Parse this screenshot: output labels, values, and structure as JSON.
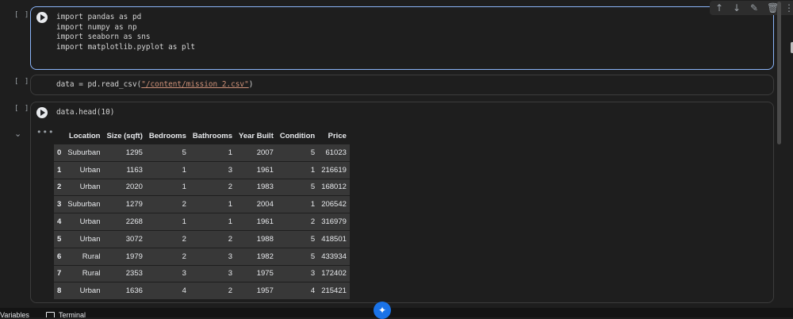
{
  "cells": [
    {
      "bracket": "[ ]",
      "code": "import pandas as pd\nimport numpy as np\nimport seaborn as sns\nimport matplotlib.pyplot as plt"
    },
    {
      "bracket": "[ ]",
      "code_pre": "data = pd.read_csv(",
      "code_str": "\"/content/mission 2.csv\"",
      "code_post": ")"
    },
    {
      "bracket": "[ ]",
      "code": "data.head(10)"
    }
  ],
  "toolbar": {
    "up": "↑",
    "down": "↓",
    "edit": "✎",
    "delete": "🗑",
    "more": "⋮"
  },
  "output": {
    "collapse": "⌄",
    "dots": "•••",
    "columns": [
      "",
      "Location",
      "Size (sqft)",
      "Bedrooms",
      "Bathrooms",
      "Year Built",
      "Condition",
      "Price"
    ],
    "rows": [
      [
        "0",
        "Suburban",
        "1295",
        "5",
        "1",
        "2007",
        "5",
        "61023"
      ],
      [
        "1",
        "Urban",
        "1163",
        "1",
        "3",
        "1961",
        "1",
        "216619"
      ],
      [
        "2",
        "Urban",
        "2020",
        "1",
        "2",
        "1983",
        "5",
        "168012"
      ],
      [
        "3",
        "Suburban",
        "1279",
        "2",
        "1",
        "2004",
        "1",
        "206542"
      ],
      [
        "4",
        "Urban",
        "2268",
        "1",
        "1",
        "1961",
        "2",
        "316979"
      ],
      [
        "5",
        "Urban",
        "3072",
        "2",
        "2",
        "1988",
        "5",
        "418501"
      ],
      [
        "6",
        "Rural",
        "1979",
        "2",
        "3",
        "1982",
        "5",
        "433934"
      ],
      [
        "7",
        "Rural",
        "2353",
        "3",
        "3",
        "1975",
        "3",
        "172402"
      ],
      [
        "8",
        "Urban",
        "1636",
        "4",
        "2",
        "1957",
        "4",
        "215421"
      ]
    ]
  },
  "bottom_bar": {
    "variables": "Variables",
    "terminal": "Terminal"
  },
  "gemini": "✦",
  "colors": {
    "accent": "#8ab4f8",
    "string": "#ce9178",
    "gemini": "#1a73e8"
  }
}
